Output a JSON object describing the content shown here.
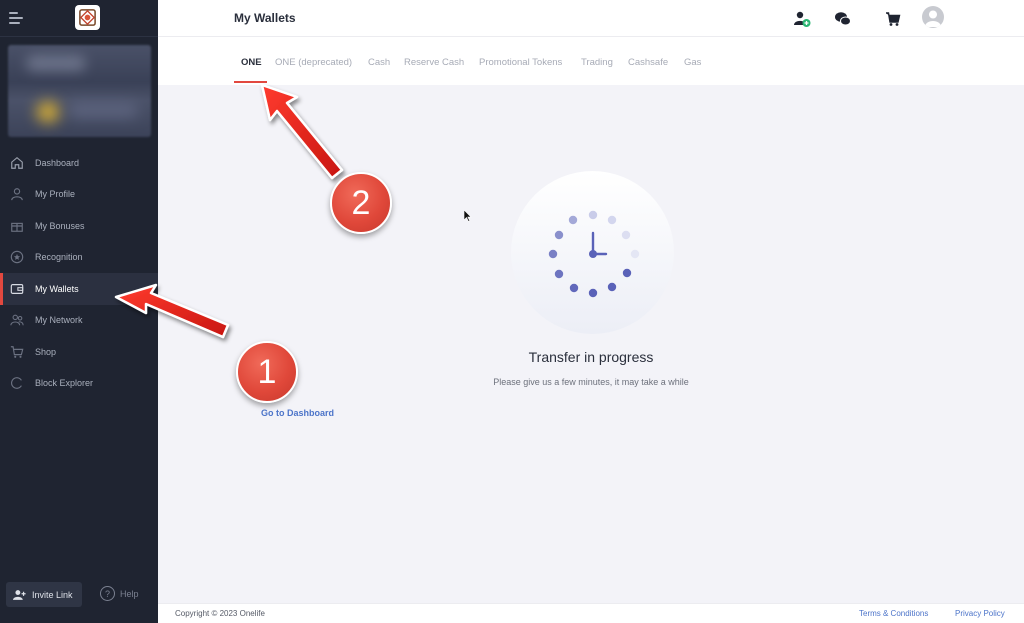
{
  "sidebar": {
    "items": [
      {
        "label": "Dashboard",
        "icon": "home-icon"
      },
      {
        "label": "My Profile",
        "icon": "user-icon"
      },
      {
        "label": "My Bonuses",
        "icon": "gift-icon"
      },
      {
        "label": "Recognition",
        "icon": "star-badge-icon"
      },
      {
        "label": "My Wallets",
        "icon": "wallet-icon",
        "active": true
      },
      {
        "label": "My Network",
        "icon": "network-icon"
      },
      {
        "label": "Shop",
        "icon": "cart-icon"
      },
      {
        "label": "Block Explorer",
        "icon": "loader-icon"
      }
    ],
    "invite_label": "Invite Link",
    "help_label": "Help"
  },
  "header": {
    "title": "My Wallets"
  },
  "tabs": [
    {
      "label": "ONE",
      "active": true
    },
    {
      "label": "ONE (deprecated)"
    },
    {
      "label": "Cash"
    },
    {
      "label": "Reserve Cash"
    },
    {
      "label": "Promotional Tokens"
    },
    {
      "label": "Trading"
    },
    {
      "label": "Cashsafe"
    },
    {
      "label": "Gas"
    }
  ],
  "main": {
    "title": "Transfer in progress",
    "subtitle": "Please give us a few minutes, it may take a while",
    "link": "Go to Dashboard"
  },
  "footer": {
    "copyright": "Copyright © 2023 Onelife",
    "terms": "Terms & Conditions",
    "privacy": "Privacy Policy"
  },
  "annotations": {
    "badge_1": "1",
    "badge_2": "2"
  },
  "colors": {
    "sidebar_bg": "#1f2431",
    "accent": "#e2483f",
    "link": "#4c74c9",
    "clock": "#5a62b8"
  }
}
